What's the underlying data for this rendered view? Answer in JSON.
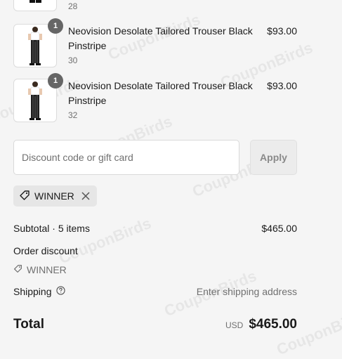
{
  "line_items": [
    {
      "title": "",
      "size": "28",
      "price": "",
      "qty": ""
    },
    {
      "title": "Neovision Desolate Tailored Trouser Black Pinstripe",
      "size": "30",
      "price": "$93.00",
      "qty": "1"
    },
    {
      "title": "Neovision Desolate Tailored Trouser Black Pinstripe",
      "size": "32",
      "price": "$93.00",
      "qty": "1"
    }
  ],
  "discount": {
    "placeholder": "Discount code or gift card",
    "apply_label": "Apply",
    "applied_code": "WINNER"
  },
  "summary": {
    "subtotal_label": "Subtotal · 5 items",
    "subtotal_value": "$465.00",
    "order_discount_label": "Order discount",
    "order_discount_code": "WINNER",
    "shipping_label": "Shipping",
    "shipping_value": "Enter shipping address",
    "total_label": "Total",
    "currency": "USD",
    "total_value": "$465.00"
  },
  "watermark_text": "CouponBirds",
  "icons": {
    "tag": "tag-icon",
    "close": "close-icon",
    "help": "help-circle-icon"
  }
}
